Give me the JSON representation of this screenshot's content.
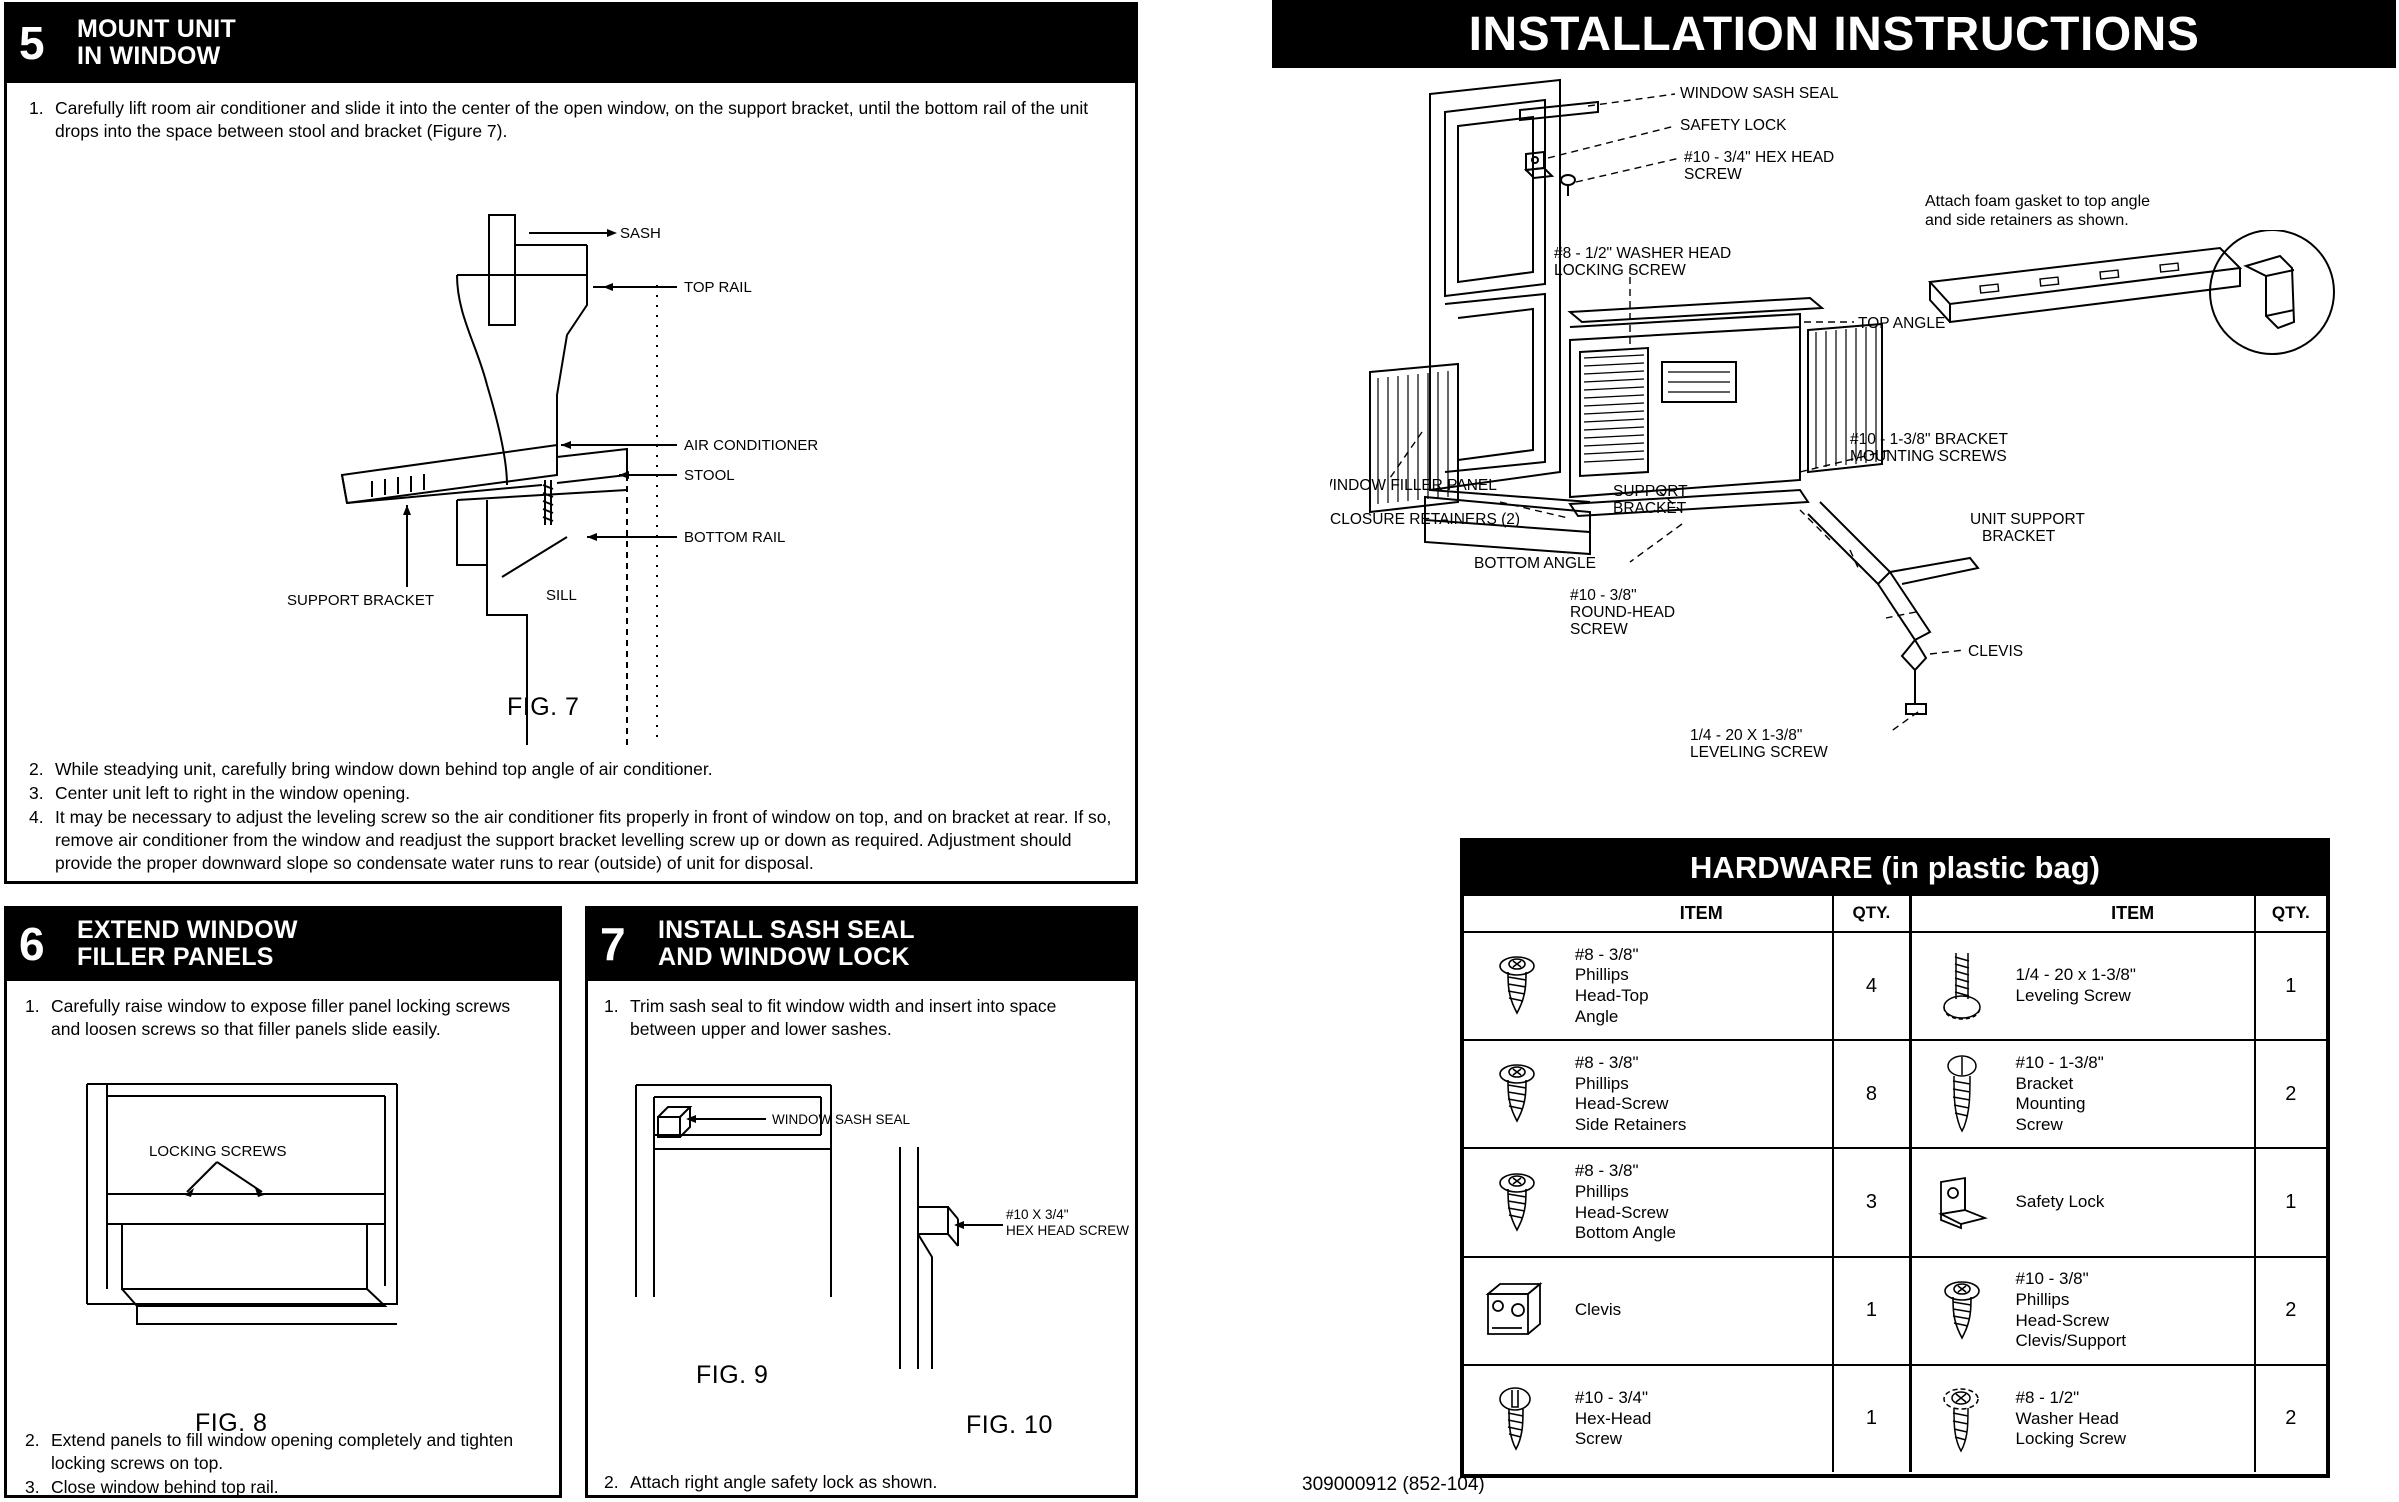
{
  "doc": {
    "title": "INSTALLATION INSTRUCTIONS",
    "code": "309000912 (852-104)"
  },
  "steps": [
    {
      "number": "5",
      "title_line1": "MOUNT UNIT",
      "title_line2": "IN WINDOW",
      "intro": [
        {
          "n": "1.",
          "t": "Carefully lift room air conditioner and slide it into the center of the open window, on the support bracket, until the bottom rail of the unit drops into the  space between stool and bracket (Figure 7)."
        }
      ],
      "outro": [
        {
          "n": "2.",
          "t": "While steadying unit, carefully bring window down behind top angle of air  conditioner."
        },
        {
          "n": "3.",
          "t": "Center unit left to right in the window opening."
        },
        {
          "n": "4.",
          "t": "It may be necessary to adjust the leveling screw so the air conditioner fits properly in front of window on top, and on bracket at rear. If so, remove air conditioner from the window and readjust the support bracket levelling screw up or down as required. Adjustment should provide the proper downward slope so condensate water runs to rear (outside) of unit for disposal."
        }
      ],
      "figure_caption": "FIG. 7",
      "figure_labels": {
        "sash": "SASH",
        "top_rail": "TOP RAIL",
        "air_conditioner": "AIR CONDITIONER",
        "stool": "STOOL",
        "bottom_rail": "BOTTOM RAIL",
        "sill": "SILL",
        "support_bracket": "SUPPORT BRACKET"
      }
    },
    {
      "number": "6",
      "title_line1": "EXTEND WINDOW",
      "title_line2": "FILLER PANELS",
      "intro": [
        {
          "n": "1.",
          "t": "Carefully raise window to expose filler panel locking screws and loosen screws so that filler panels slide easily."
        }
      ],
      "outro": [
        {
          "n": "2.",
          "t": "Extend panels to fill window opening completely and tighten locking screws on top."
        },
        {
          "n": "3.",
          "t": "Close window behind top rail."
        }
      ],
      "figure_caption": "FIG. 8",
      "figure_labels": {
        "locking_screws": "LOCKING SCREWS"
      }
    },
    {
      "number": "7",
      "title_line1": "INSTALL SASH SEAL",
      "title_line2": "AND WINDOW LOCK",
      "intro": [
        {
          "n": "1.",
          "t": "Trim sash seal to fit window width and insert into space between upper and lower sashes."
        }
      ],
      "outro": [
        {
          "n": "2.",
          "t": "Attach right angle safety lock as shown."
        }
      ],
      "figure_caption_left": "FIG. 9",
      "figure_caption_right": "FIG. 10",
      "figure_labels": {
        "window_sash_seal": "WINDOW SASH SEAL",
        "hex_head_screw": "#10 X 3/4\"\nHEX HEAD SCREW"
      }
    }
  ],
  "main_diagram": {
    "note": "Attach foam gasket to top angle\nand side retainers as shown.",
    "labels": {
      "window_sash_seal": "WINDOW SASH SEAL",
      "safety_lock": "SAFETY LOCK",
      "hex_head_screw": "#10 - 3/4\" HEX HEAD\nSCREW",
      "washer_head_locking_screw": "#8 - 1/2\" WASHER HEAD\nLOCKING SCREW",
      "top_angle": "TOP ANGLE",
      "bracket_mounting_screws": "#10 - 1-3/8\" BRACKET\nMOUNTING SCREWS",
      "window_filler_panel": "WINDOW FILLER PANEL",
      "closure_retainers": "CLOSURE RETAINERS (2)",
      "support_bracket": "SUPPORT\nBRACKET",
      "bottom_angle": "BOTTOM ANGLE",
      "round_head_screw": "#10 - 3/8\"\nROUND-HEAD\nSCREW",
      "unit_support_bracket": "UNIT SUPPORT\nBRACKET",
      "clevis": "CLEVIS",
      "leveling_screw": "1/4 - 20 X 1-3/8\"\nLEVELING SCREW"
    }
  },
  "hardware": {
    "title": "HARDWARE (in plastic bag)",
    "columns": {
      "item": "ITEM",
      "qty": "QTY."
    },
    "left_rows": [
      {
        "icon": "phillips-pan-screw-icon",
        "item": "#8 - 3/8\"\nPhillips\nHead-Top\nAngle",
        "qty": "4"
      },
      {
        "icon": "phillips-pan-screw-icon",
        "item": "#8 - 3/8\"\nPhillips\nHead-Screw\nSide Retainers",
        "qty": "8"
      },
      {
        "icon": "phillips-pan-screw-icon",
        "item": "#8 - 3/8\"\nPhillips\nHead-Screw\nBottom Angle",
        "qty": "3"
      },
      {
        "icon": "clevis-icon",
        "item": "Clevis",
        "qty": "1"
      },
      {
        "icon": "hex-head-screw-icon",
        "item": "#10 - 3/4\"\nHex-Head\nScrew",
        "qty": "1"
      }
    ],
    "right_rows": [
      {
        "icon": "leveling-screw-icon",
        "item": "1/4 - 20 x 1-3/8\"\nLeveling Screw",
        "qty": "1"
      },
      {
        "icon": "bracket-mounting-screw-icon",
        "item": "#10 - 1-3/8\"\nBracket\nMounting\nScrew",
        "qty": "2"
      },
      {
        "icon": "safety-lock-icon",
        "item": "Safety Lock",
        "qty": "1"
      },
      {
        "icon": "phillips-pan-screw-icon",
        "item": "#10 - 3/8\"\nPhillips\nHead-Screw\nClevis/Support",
        "qty": "2"
      },
      {
        "icon": "washer-head-screw-icon",
        "item": "#8 - 1/2\"\nWasher Head\nLocking Screw",
        "qty": "2"
      }
    ]
  }
}
